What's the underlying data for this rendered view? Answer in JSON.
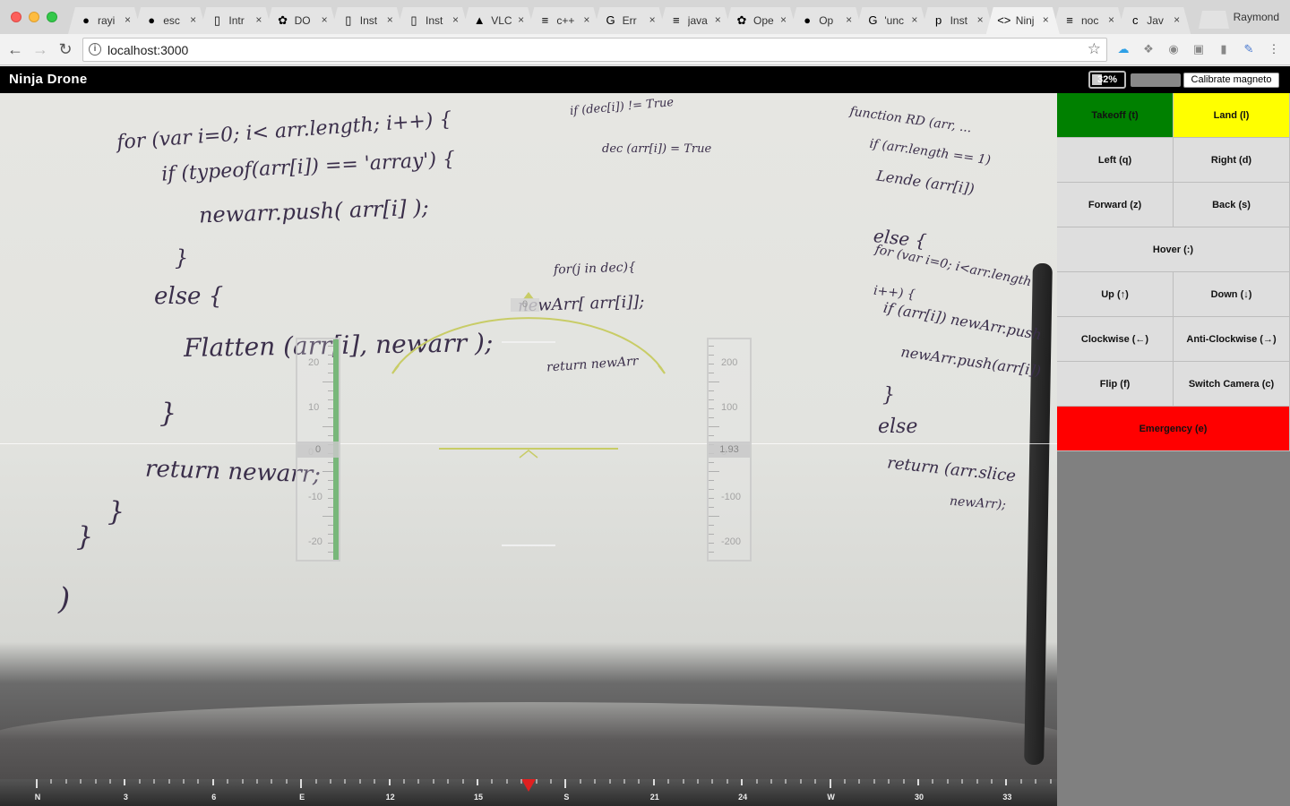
{
  "browser": {
    "tabs": [
      {
        "title": "rayi",
        "icon": "github-icon",
        "glyph": "●"
      },
      {
        "title": "esc",
        "icon": "github-icon",
        "glyph": "●"
      },
      {
        "title": "Intr",
        "icon": "document-icon",
        "glyph": "▯"
      },
      {
        "title": "DO",
        "icon": "colorful-logo-icon",
        "glyph": "✿"
      },
      {
        "title": "Inst",
        "icon": "document-icon",
        "glyph": "▯"
      },
      {
        "title": "Inst",
        "icon": "document-icon",
        "glyph": "▯"
      },
      {
        "title": "VLC",
        "icon": "vlc-icon",
        "glyph": "▲"
      },
      {
        "title": "c++",
        "icon": "stackoverflow-icon",
        "glyph": "≡"
      },
      {
        "title": "Err",
        "icon": "google-icon",
        "glyph": "G"
      },
      {
        "title": "java",
        "icon": "stackoverflow-icon",
        "glyph": "≡"
      },
      {
        "title": "Ope",
        "icon": "colorful-logo-icon",
        "glyph": "✿"
      },
      {
        "title": "Op",
        "icon": "github-icon",
        "glyph": "●"
      },
      {
        "title": "'unc",
        "icon": "google-icon",
        "glyph": "G"
      },
      {
        "title": "Inst",
        "icon": "p-icon",
        "glyph": "p"
      },
      {
        "title": "Ninj",
        "icon": "angular-brackets-icon",
        "glyph": "<>"
      },
      {
        "title": "noc",
        "icon": "stackoverflow-icon",
        "glyph": "≡"
      },
      {
        "title": "Jav",
        "icon": "codepen-icon",
        "glyph": "c"
      }
    ],
    "profile_name": "Raymond",
    "url": "localhost:3000"
  },
  "app": {
    "title": "Ninja Drone",
    "battery_label": "32%",
    "battery_level": 0.32,
    "calibrate_label": "Calibrate magneto"
  },
  "hud": {
    "left_tape": {
      "labels": [
        "20",
        "10",
        "0",
        "-10",
        "-20"
      ],
      "readout": "0"
    },
    "right_tape": {
      "labels": [
        "200",
        "100",
        "0",
        "-100",
        "-200"
      ],
      "readout": "1.93"
    },
    "arc_label": "0"
  },
  "compass": {
    "labels": [
      "N",
      "3",
      "6",
      "E",
      "12",
      "15",
      "S",
      "21",
      "24",
      "W",
      "30",
      "33"
    ]
  },
  "controls": [
    {
      "label": "Takeoff (t)",
      "name": "takeoff-button",
      "color": "#008000",
      "col": "left"
    },
    {
      "label": "Land (l)",
      "name": "land-button",
      "color": "#ffff00",
      "col": "right"
    },
    {
      "label": "Left (q)",
      "name": "left-button",
      "color": "#dedede",
      "col": "left"
    },
    {
      "label": "Right (d)",
      "name": "right-button",
      "color": "#dedede",
      "col": "right"
    },
    {
      "label": "Forward (z)",
      "name": "forward-button",
      "color": "#dedede",
      "col": "left"
    },
    {
      "label": "Back (s)",
      "name": "back-button",
      "color": "#dedede",
      "col": "right"
    },
    {
      "label": "Hover (:)",
      "name": "hover-button",
      "color": "#dedede",
      "col": "full"
    },
    {
      "label": "Up (↑)",
      "name": "up-button",
      "color": "#dedede",
      "col": "left"
    },
    {
      "label": "Down (↓)",
      "name": "down-button",
      "color": "#dedede",
      "col": "right"
    },
    {
      "label": "Clockwise (←)",
      "name": "clockwise-button",
      "color": "#dedede",
      "col": "left"
    },
    {
      "label": "Anti-Clockwise (→)",
      "name": "anti-clockwise-button",
      "color": "#dedede",
      "col": "right"
    },
    {
      "label": "Flip (f)",
      "name": "flip-button",
      "color": "#dedede",
      "col": "left"
    },
    {
      "label": "Switch Camera (c)",
      "name": "switch-camera-button",
      "color": "#dedede",
      "col": "right"
    },
    {
      "label": "Emergency (e)",
      "name": "emergency-button",
      "color": "#ff0000",
      "col": "full"
    }
  ]
}
